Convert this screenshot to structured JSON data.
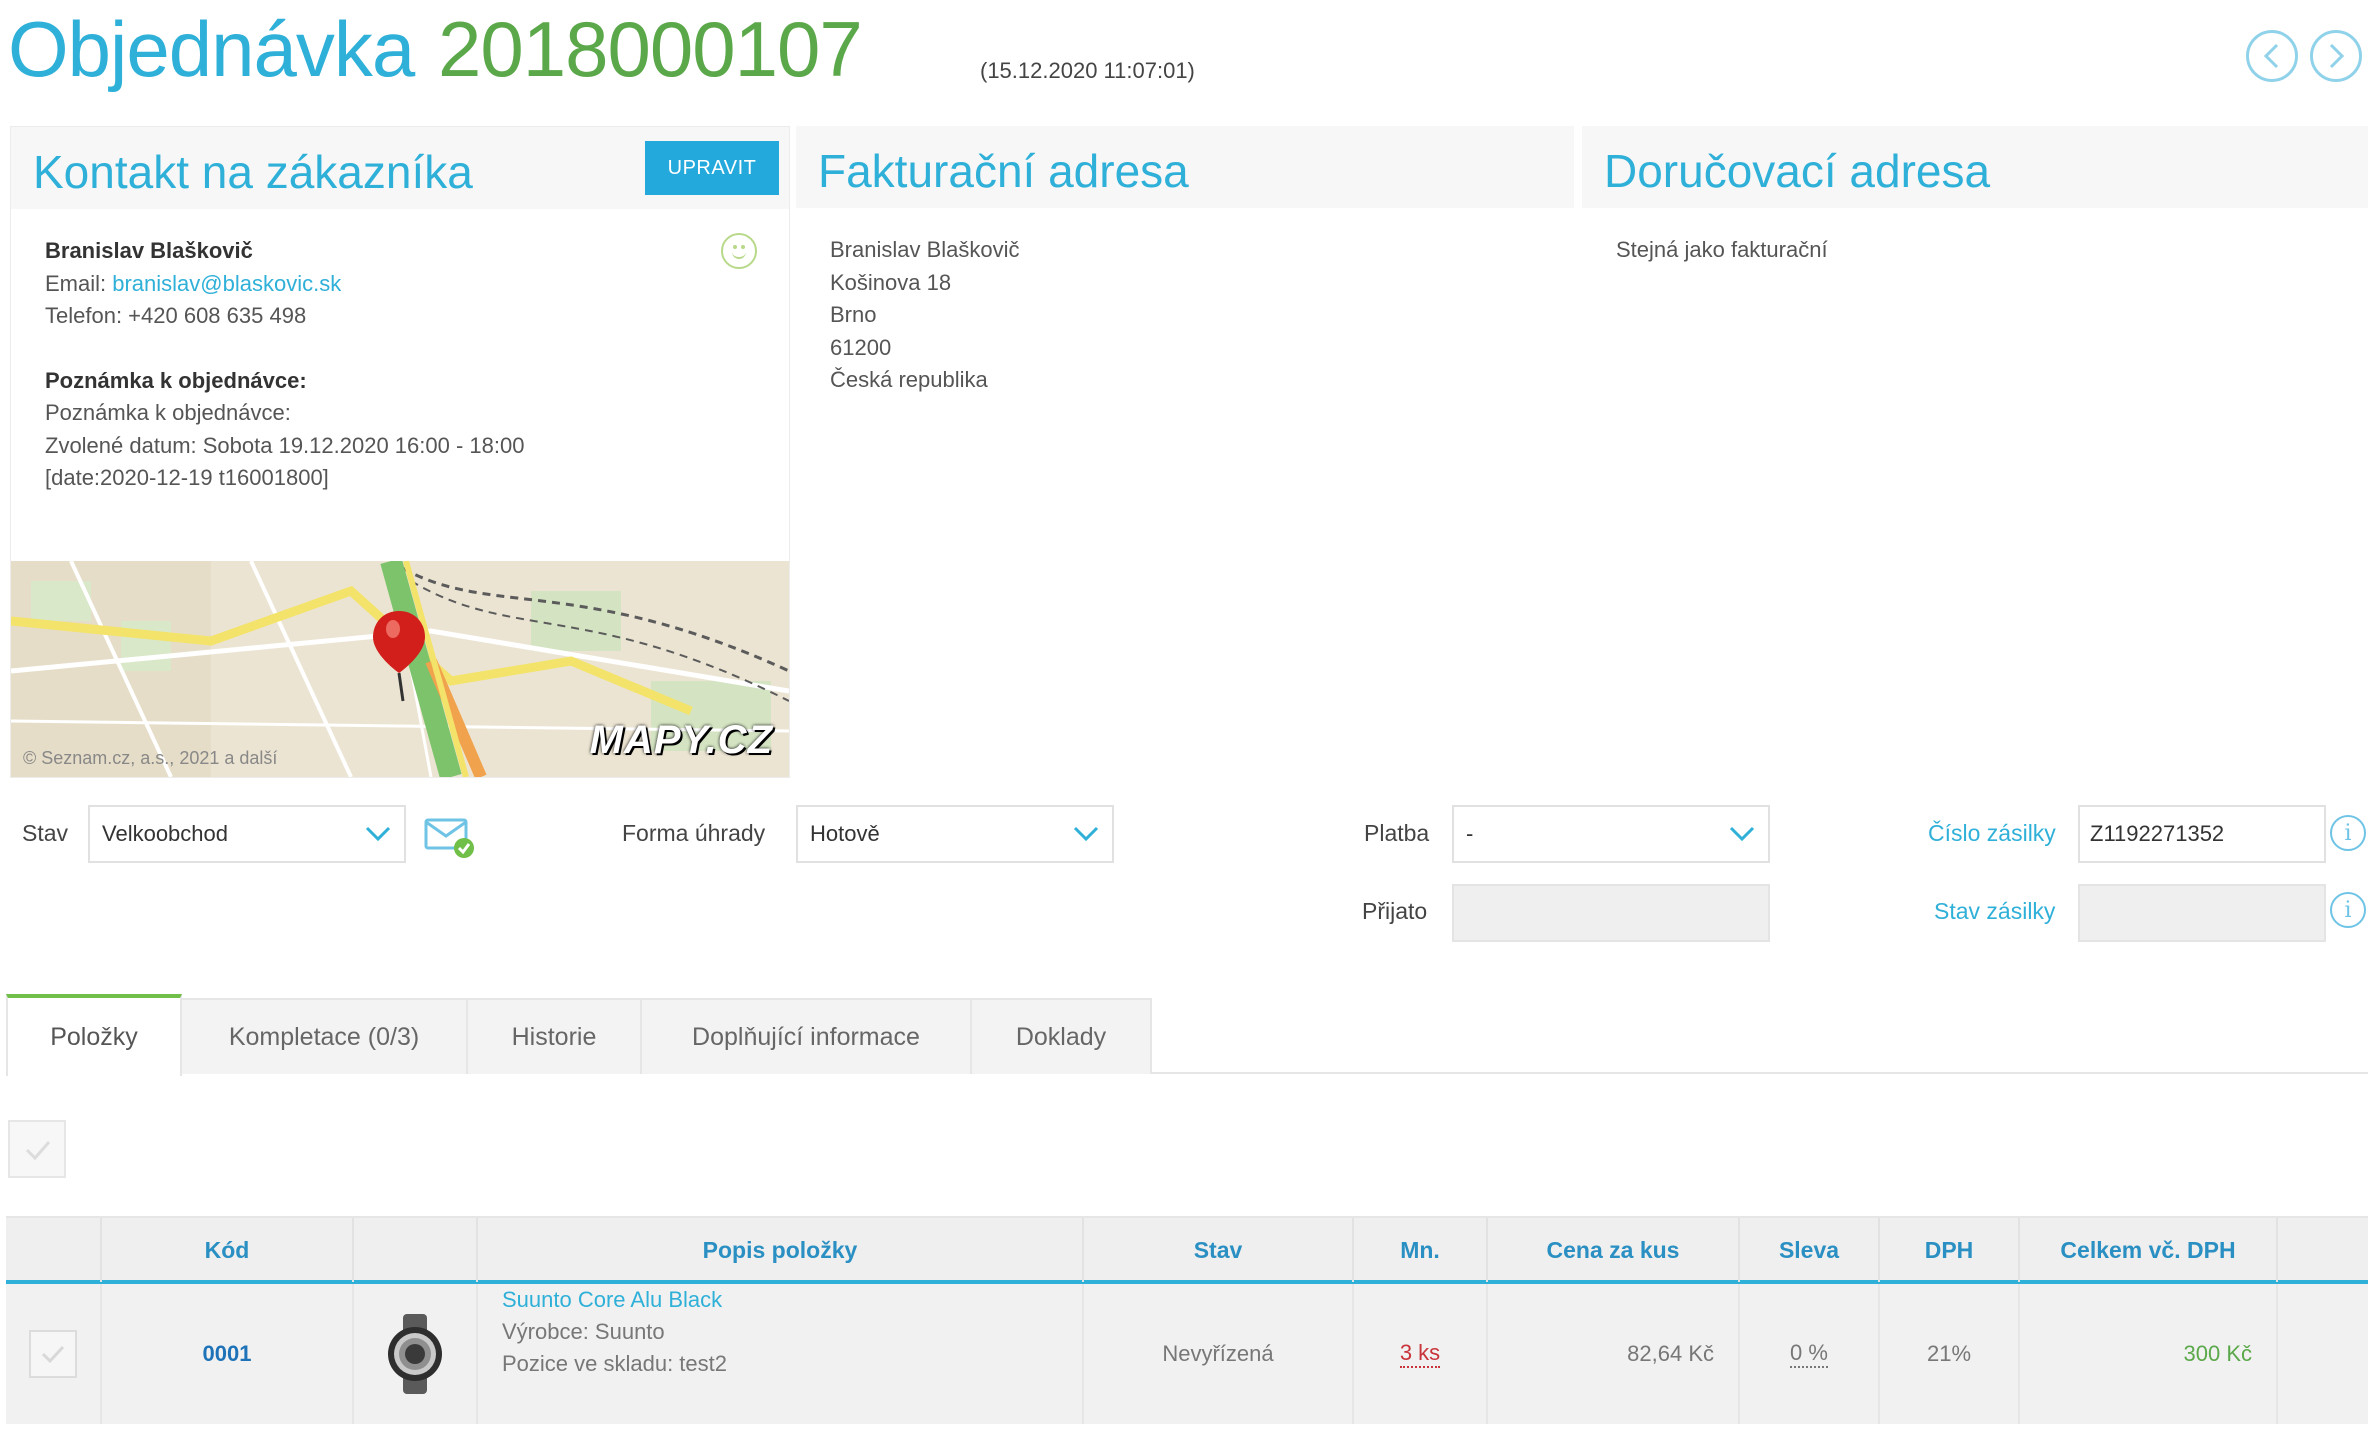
{
  "header": {
    "title": "Objednávka",
    "order_number": "2018000107",
    "created": "(15.12.2020 11:07:01)",
    "prev_icon": "chevron-left-icon",
    "next_icon": "chevron-right-icon"
  },
  "customer_card": {
    "title": "Kontakt na zákazníka",
    "edit_label": "UPRAVIT",
    "name": "Branislav Blaškovič",
    "email_label": "Email:",
    "email": "branislav@blaskovic.sk",
    "phone": "Telefon: +420 608 635 498",
    "note_heading": "Poznámka k objednávce:",
    "note_lines": [
      "Poznámka k objednávce:",
      "Zvolené datum: Sobota 19.12.2020 16:00 - 18:00",
      "[date:2020-12-19 t16001800]"
    ],
    "map_logo": "MAPY.CZ",
    "map_copyright": "© Seznam.cz, a.s., 2021 a další"
  },
  "billing_card": {
    "title": "Fakturační adresa",
    "lines": [
      "Branislav Blaškovič",
      "Košinova 18",
      "Brno",
      "61200",
      "Česká republika"
    ]
  },
  "delivery_card": {
    "title": "Doručovací adresa",
    "text": "Stejná jako fakturační"
  },
  "form": {
    "status_label": "Stav",
    "status_value": "Velkoobchod",
    "payment_method_label": "Forma úhrady",
    "payment_method_value": "Hotově",
    "payment_label": "Platba",
    "payment_value": "-",
    "received_label": "Přijato",
    "received_value": "",
    "shipment_number_label": "Číslo zásilky",
    "shipment_number_value": "Z1192271352",
    "shipment_status_label": "Stav zásilky",
    "shipment_status_value": ""
  },
  "tabs": [
    {
      "label": "Položky",
      "active": true
    },
    {
      "label": "Kompletace (0/3)",
      "active": false
    },
    {
      "label": "Historie",
      "active": false
    },
    {
      "label": "Doplňující informace",
      "active": false
    },
    {
      "label": "Doklady",
      "active": false
    }
  ],
  "table": {
    "headers": [
      "Kód",
      "Popis položky",
      "Stav",
      "Mn.",
      "Cena za kus",
      "Sleva",
      "DPH",
      "Celkem vč. DPH"
    ],
    "rows": [
      {
        "code": "0001",
        "name": "Suunto Core Alu Black",
        "manufacturer": "Výrobce: Suunto",
        "position": "Pozice ve skladu: test2",
        "status": "Nevyřízená",
        "qty": "3 ks",
        "unit_price": "82,64 Kč",
        "discount": "0 %",
        "vat": "21%",
        "total": "300 Kč"
      }
    ]
  },
  "colors": {
    "accent": "#2fb0d8",
    "order_number": "#5ba84a",
    "edit_button": "#23a9dc",
    "active_tab": "#6fbf48",
    "quantity": "#c8343a"
  }
}
